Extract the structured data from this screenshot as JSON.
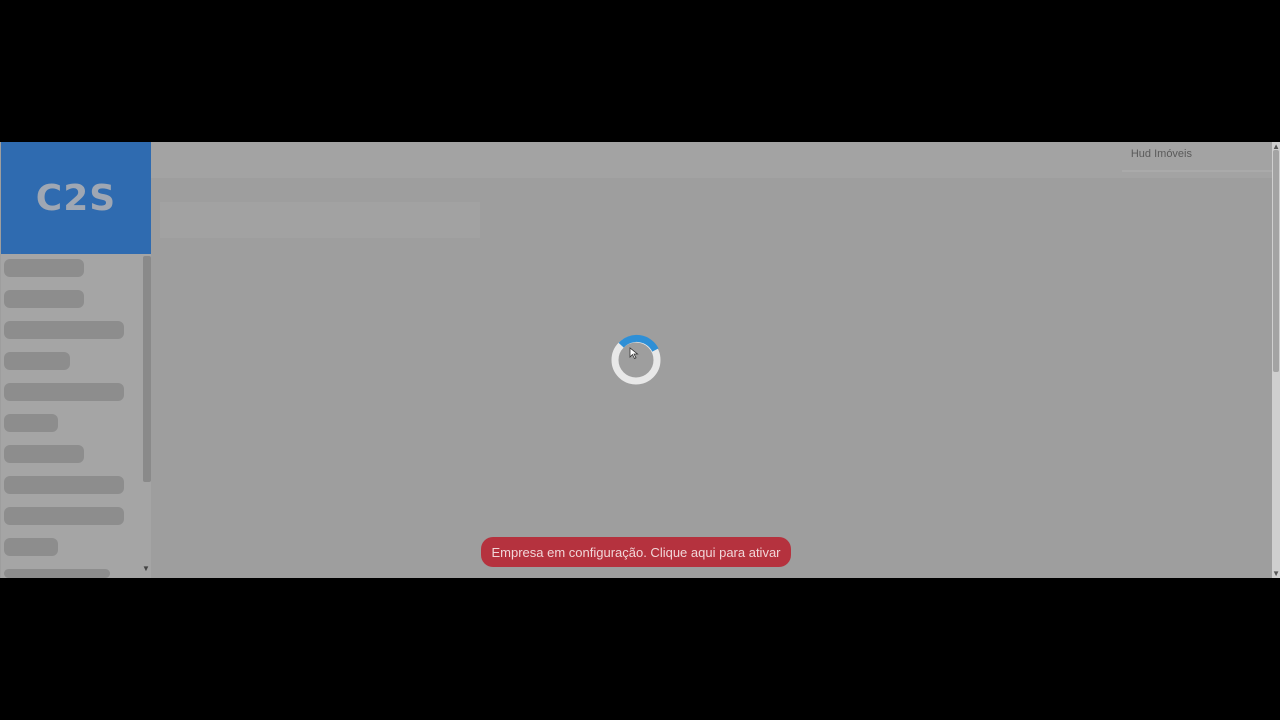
{
  "app": {
    "logo_text": "C2S",
    "company_name": "Hud Imóveis"
  },
  "banner": {
    "text": "Empresa em configuração. Clique aqui para ativar"
  },
  "colors": {
    "brand": "#2f6bb0",
    "spinner_accent": "#2e8fd6",
    "banner": "#b5323e"
  },
  "status": {
    "loading": true
  }
}
